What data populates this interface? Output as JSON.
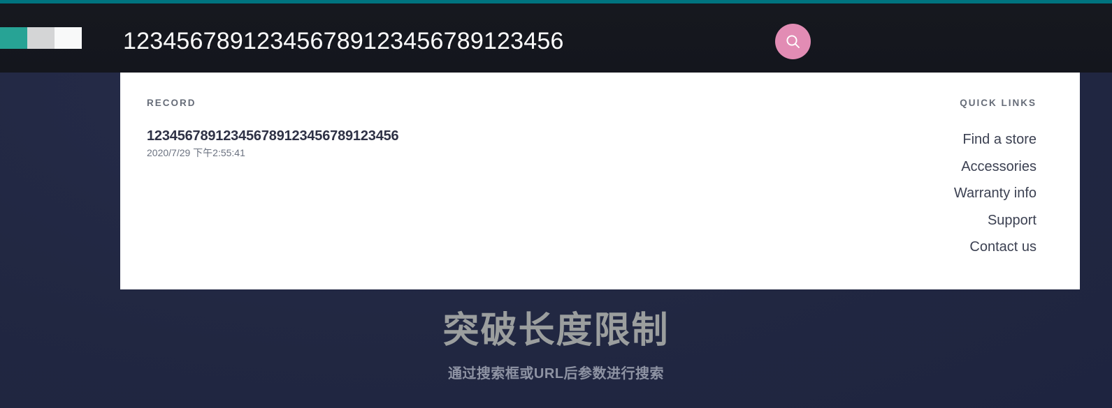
{
  "colors": {
    "accent_bar": "#00737f",
    "header_bg": "#15171f",
    "page_bg": "#242a47",
    "card_bg": "#ffffff",
    "logo_teal": "#27a395",
    "logo_gray": "#d4d5d6",
    "logo_white": "#f8f9f9",
    "search_button_pink": "#e28cb4",
    "hero_text": "#9b9e9e"
  },
  "header": {
    "title": "123456789123456789123456789123456",
    "search_icon": "search-icon",
    "logo_alt": "three-block-logo"
  },
  "card": {
    "record": {
      "heading": "RECORD",
      "title": "123456789123456789123456789123456",
      "timestamp": "2020/7/29 下午2:55:41"
    },
    "quick_links": {
      "heading": "QUICK LINKS",
      "items": [
        {
          "label": "Find a store"
        },
        {
          "label": "Accessories"
        },
        {
          "label": "Warranty info"
        },
        {
          "label": "Support"
        },
        {
          "label": "Contact us"
        }
      ]
    }
  },
  "hero": {
    "title": "突破长度限制",
    "subtitle": "通过搜索框或URL后参数进行搜索"
  }
}
